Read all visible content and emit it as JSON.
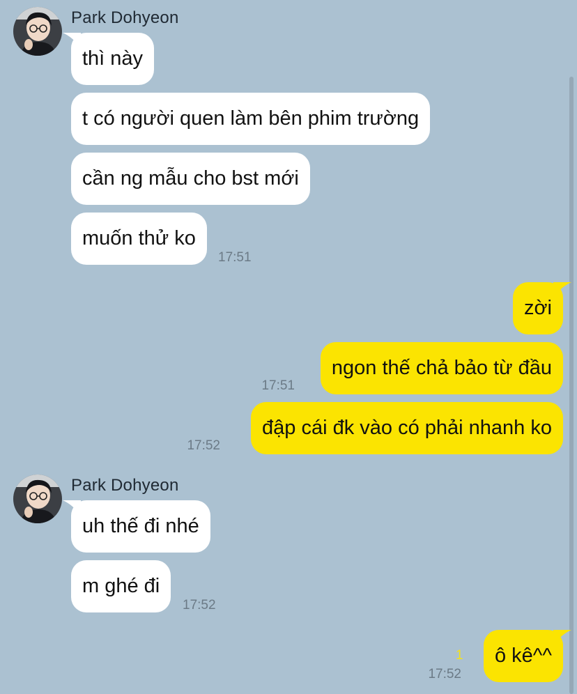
{
  "colors": {
    "background": "#abc1d1",
    "incoming_bubble": "#ffffff",
    "outgoing_bubble": "#fbe401",
    "timestamp": "#6b7a86",
    "unread": "#f4e21a"
  },
  "groups": [
    {
      "sender": "Park Dohyeon",
      "avatar_icon": "profile-photo-avatar",
      "messages": [
        "thì này",
        "t có người quen làm bên phim trường",
        "cần ng mẫu cho bst mới",
        "muốn thử ko"
      ],
      "time": "17:51"
    },
    {
      "outgoing": true,
      "messages": [
        {
          "text": "zời"
        },
        {
          "text": "ngon thế chả bảo từ đầu",
          "time": "17:51"
        },
        {
          "text": "đập cái đk vào có phải nhanh ko",
          "time": "17:52"
        }
      ]
    },
    {
      "sender": "Park Dohyeon",
      "avatar_icon": "profile-photo-avatar",
      "messages": [
        "uh thế đi nhé",
        "m ghé đi"
      ],
      "time": "17:52"
    },
    {
      "outgoing": true,
      "messages": [
        {
          "text": "ô kê^^",
          "time": "17:52",
          "unread": "1"
        }
      ]
    }
  ]
}
